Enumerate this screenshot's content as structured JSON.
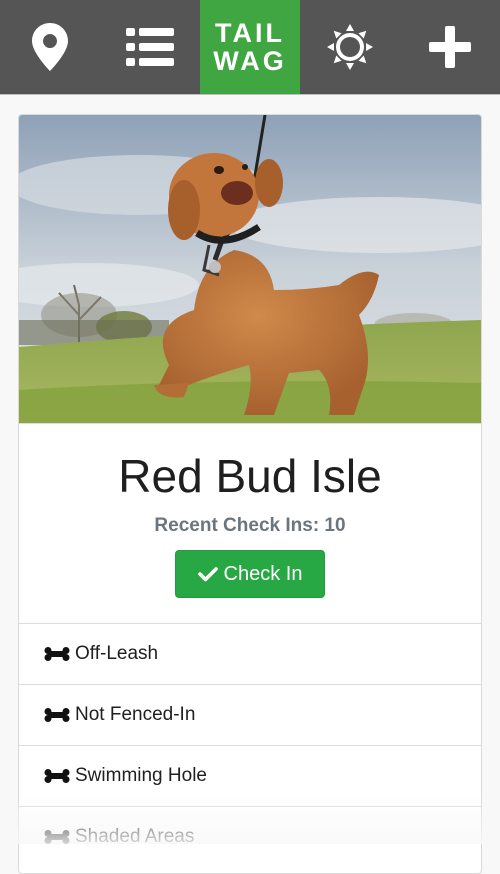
{
  "nav": {
    "logo_line1": "TAIL",
    "logo_line2": "WAG",
    "icons": [
      "location-pin-icon",
      "list-icon",
      "settings-sun-icon",
      "plus-icon"
    ],
    "background": "#555555",
    "logo_background": "#3fa642"
  },
  "park": {
    "name": "Red Bud Isle",
    "checkins_text": "Recent Check Ins: 10",
    "checkin_button_label": "Check In",
    "button_color": "#28a745",
    "features": [
      "Off-Leash",
      "Not Fenced-In",
      "Swimming Hole",
      "Shaded Areas"
    ]
  }
}
